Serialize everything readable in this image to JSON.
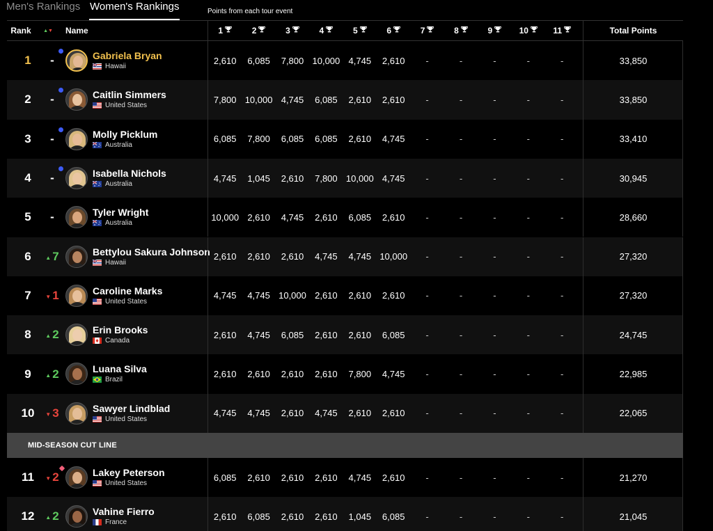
{
  "tabs": {
    "men": "Men's Rankings",
    "women": "Women's Rankings",
    "active": "women"
  },
  "events_note": "Points from each tour event",
  "header": {
    "rank": "Rank",
    "name": "Name",
    "events": [
      "1",
      "2",
      "3",
      "4",
      "5",
      "6",
      "7",
      "8",
      "9",
      "10",
      "11"
    ],
    "total": "Total Points"
  },
  "colors": {
    "gold": "#f2c14e",
    "up": "#5ec95e",
    "down": "#e8453c",
    "jersey_dot": "#3d5bf5",
    "cutline_bg": "#444444"
  },
  "cutline_label": "MID-SEASON CUT LINE",
  "rows": [
    {
      "rank": "1",
      "move": "-",
      "dir": "none",
      "name": "Gabriela Bryan",
      "country": "Hawaii",
      "flag": "flag-hawaii",
      "dot": "circle",
      "leader": true,
      "points": [
        "2,610",
        "6,085",
        "7,800",
        "10,000",
        "4,745",
        "2,610",
        "-",
        "-",
        "-",
        "-",
        "-"
      ],
      "total": "33,850"
    },
    {
      "rank": "2",
      "move": "-",
      "dir": "none",
      "name": "Caitlin Simmers",
      "country": "United States",
      "flag": "flag-usa",
      "dot": "circle",
      "leader": false,
      "points": [
        "7,800",
        "10,000",
        "4,745",
        "6,085",
        "2,610",
        "2,610",
        "-",
        "-",
        "-",
        "-",
        "-"
      ],
      "total": "33,850"
    },
    {
      "rank": "3",
      "move": "-",
      "dir": "none",
      "name": "Molly Picklum",
      "country": "Australia",
      "flag": "flag-australia",
      "dot": "circle",
      "leader": false,
      "points": [
        "6,085",
        "7,800",
        "6,085",
        "6,085",
        "2,610",
        "4,745",
        "-",
        "-",
        "-",
        "-",
        "-"
      ],
      "total": "33,410"
    },
    {
      "rank": "4",
      "move": "-",
      "dir": "none",
      "name": "Isabella Nichols",
      "country": "Australia",
      "flag": "flag-australia",
      "dot": "circle",
      "leader": false,
      "points": [
        "4,745",
        "1,045",
        "2,610",
        "7,800",
        "10,000",
        "4,745",
        "-",
        "-",
        "-",
        "-",
        "-"
      ],
      "total": "30,945"
    },
    {
      "rank": "5",
      "move": "-",
      "dir": "none",
      "name": "Tyler Wright",
      "country": "Australia",
      "flag": "flag-australia",
      "dot": "none",
      "leader": false,
      "points": [
        "10,000",
        "2,610",
        "4,745",
        "2,610",
        "6,085",
        "2,610",
        "-",
        "-",
        "-",
        "-",
        "-"
      ],
      "total": "28,660"
    },
    {
      "rank": "6",
      "move": "7",
      "dir": "up",
      "name": "Bettylou Sakura Johnson",
      "country": "Hawaii",
      "flag": "flag-hawaii",
      "dot": "none",
      "leader": false,
      "points": [
        "2,610",
        "2,610",
        "2,610",
        "4,745",
        "4,745",
        "10,000",
        "-",
        "-",
        "-",
        "-",
        "-"
      ],
      "total": "27,320"
    },
    {
      "rank": "7",
      "move": "1",
      "dir": "down",
      "name": "Caroline Marks",
      "country": "United States",
      "flag": "flag-usa",
      "dot": "none",
      "leader": false,
      "points": [
        "4,745",
        "4,745",
        "10,000",
        "2,610",
        "2,610",
        "2,610",
        "-",
        "-",
        "-",
        "-",
        "-"
      ],
      "total": "27,320"
    },
    {
      "rank": "8",
      "move": "2",
      "dir": "up",
      "name": "Erin Brooks",
      "country": "Canada",
      "flag": "flag-canada",
      "dot": "none",
      "leader": false,
      "points": [
        "2,610",
        "4,745",
        "6,085",
        "2,610",
        "2,610",
        "6,085",
        "-",
        "-",
        "-",
        "-",
        "-"
      ],
      "total": "24,745"
    },
    {
      "rank": "9",
      "move": "2",
      "dir": "up",
      "name": "Luana Silva",
      "country": "Brazil",
      "flag": "flag-brazil",
      "dot": "none",
      "leader": false,
      "points": [
        "2,610",
        "2,610",
        "2,610",
        "2,610",
        "7,800",
        "4,745",
        "-",
        "-",
        "-",
        "-",
        "-"
      ],
      "total": "22,985"
    },
    {
      "rank": "10",
      "move": "3",
      "dir": "down",
      "name": "Sawyer Lindblad",
      "country": "United States",
      "flag": "flag-usa",
      "dot": "none",
      "leader": false,
      "points": [
        "4,745",
        "4,745",
        "2,610",
        "4,745",
        "2,610",
        "2,610",
        "-",
        "-",
        "-",
        "-",
        "-"
      ],
      "total": "22,065"
    },
    {
      "rank": "11",
      "move": "2",
      "dir": "down",
      "name": "Lakey Peterson",
      "country": "United States",
      "flag": "flag-usa",
      "dot": "diamond",
      "leader": false,
      "points": [
        "6,085",
        "2,610",
        "2,610",
        "2,610",
        "4,745",
        "2,610",
        "-",
        "-",
        "-",
        "-",
        "-"
      ],
      "total": "21,270"
    },
    {
      "rank": "12",
      "move": "2",
      "dir": "up",
      "name": "Vahine Fierro",
      "country": "France",
      "flag": "flag-france",
      "dot": "none",
      "leader": false,
      "points": [
        "2,610",
        "6,085",
        "2,610",
        "2,610",
        "1,045",
        "6,085",
        "-",
        "-",
        "-",
        "-",
        "-"
      ],
      "total": "21,045"
    }
  ]
}
